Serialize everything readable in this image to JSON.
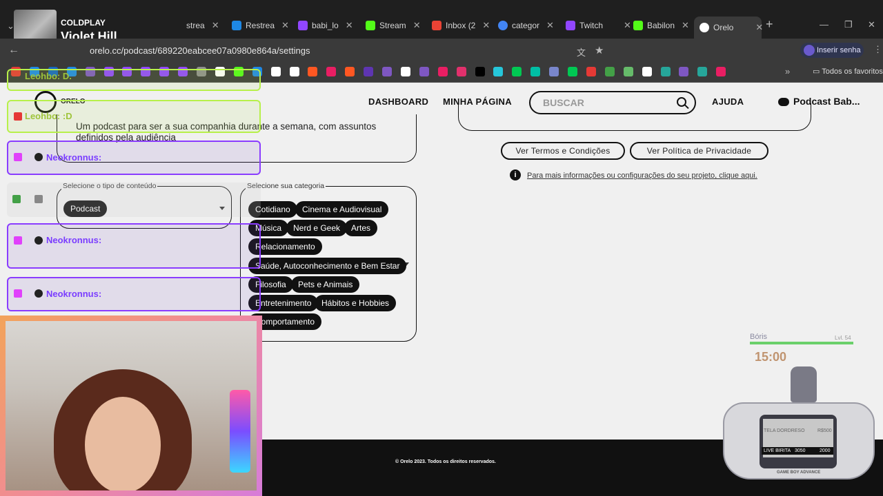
{
  "music": {
    "artist": "COLDPLAY",
    "track": "Violet Hill"
  },
  "browser": {
    "tabs": [
      {
        "label": "strea",
        "color": "#444"
      },
      {
        "label": "Restrea",
        "color": "#1e88e5"
      },
      {
        "label": "babi_lo",
        "color": "#9146ff"
      },
      {
        "label": "Stream",
        "color": "#53fc18"
      },
      {
        "label": "Inbox (2",
        "color": "#ea4335"
      },
      {
        "label": "categor",
        "color": "#4285f4"
      },
      {
        "label": "Twitch",
        "color": "#9146ff"
      },
      {
        "label": "Babilon",
        "color": "#53fc18"
      },
      {
        "label": "Orelo",
        "color": "#ffffff"
      }
    ],
    "url": "orelo.cc/podcast/689220eabcee07a0980e864a/settings",
    "signin_label": "Inserir senha",
    "favorites_label": "Todos os favoritos",
    "bookmark_colors": [
      "#e53935",
      "#1e88e5",
      "#1565c0",
      "#1e88e5",
      "#7e57c2",
      "#9146ff",
      "#9146ff",
      "#9146ff",
      "#9146ff",
      "#9146ff",
      "#8e8e8e",
      "#ffffff",
      "#53fc18",
      "#1e88e5",
      "#ffffff",
      "#ffffff",
      "#ff5722",
      "#e91e63",
      "#ff5722",
      "#5e35b1",
      "#7e57c2",
      "#ffffff",
      "#7e57c2",
      "#e91e63",
      "#e1306c",
      "#000000",
      "#26c6da",
      "#00c853",
      "#00bfa5",
      "#7986cb",
      "#00c853",
      "#e53935",
      "#43a047",
      "#66bb6a",
      "#ffffff",
      "#26a69a",
      "#7e57c2",
      "#26a69a",
      "#e91e63"
    ]
  },
  "site": {
    "logo_text": "ORELO",
    "nav": [
      "DASHBOARD",
      "MINHA PÁGINA"
    ],
    "search_placeholder": "BUSCAR",
    "help": "AJUDA",
    "user": "Podcast Bab..."
  },
  "form": {
    "description": "Um podcast para ser a sua companhia durante a semana, com assuntos definidos pela audiência",
    "content_type_legend": "Selecione o tipo de conteúdo",
    "content_type_value": "Podcast",
    "category_legend": "Selecione sua categoria",
    "categories": [
      [
        "Cotidiano",
        "Cinema e Audiovisual"
      ],
      [
        "Música",
        "Nerd e Geek",
        "Artes"
      ],
      [
        "Relacionamento"
      ],
      [
        "Saúde, Autoconhecimento e Bem Estar"
      ],
      [
        "Filosofia",
        "Pets e Animais"
      ],
      [
        "Entretenimento",
        "Hábitos e Hobbies"
      ],
      [
        "Comportamento"
      ]
    ]
  },
  "right": {
    "terms_button": "Ver Termos e Condições",
    "privacy_button": "Ver Política de Privacidade",
    "info_text": "Para mais informações ou configurações do seu projeto, clique aqui."
  },
  "footer": {
    "text": "© Orelo 2023. Todos os direitos reservados."
  },
  "chat": [
    {
      "user": "Leohbo: D.",
      "style": "green"
    },
    {
      "user": "Leohbo: :D",
      "style": "green"
    },
    {
      "user": "Neokronnus:",
      "style": "purple"
    },
    {
      "user": "Neokronnus:",
      "style": "purple"
    },
    {
      "user": "Neokronnus:",
      "style": "purple"
    }
  ],
  "pet": {
    "name": "Bóris",
    "level": "Lvl. 54",
    "timer": "15:00"
  },
  "gba": {
    "line1_left": "TELA DORDRESO",
    "line1_right": "R$500",
    "line2_left": "LIVE BIRITA",
    "line2_mid": "3050",
    "line2_right": "2000",
    "logo": "GAME BOY ADVANCE"
  }
}
